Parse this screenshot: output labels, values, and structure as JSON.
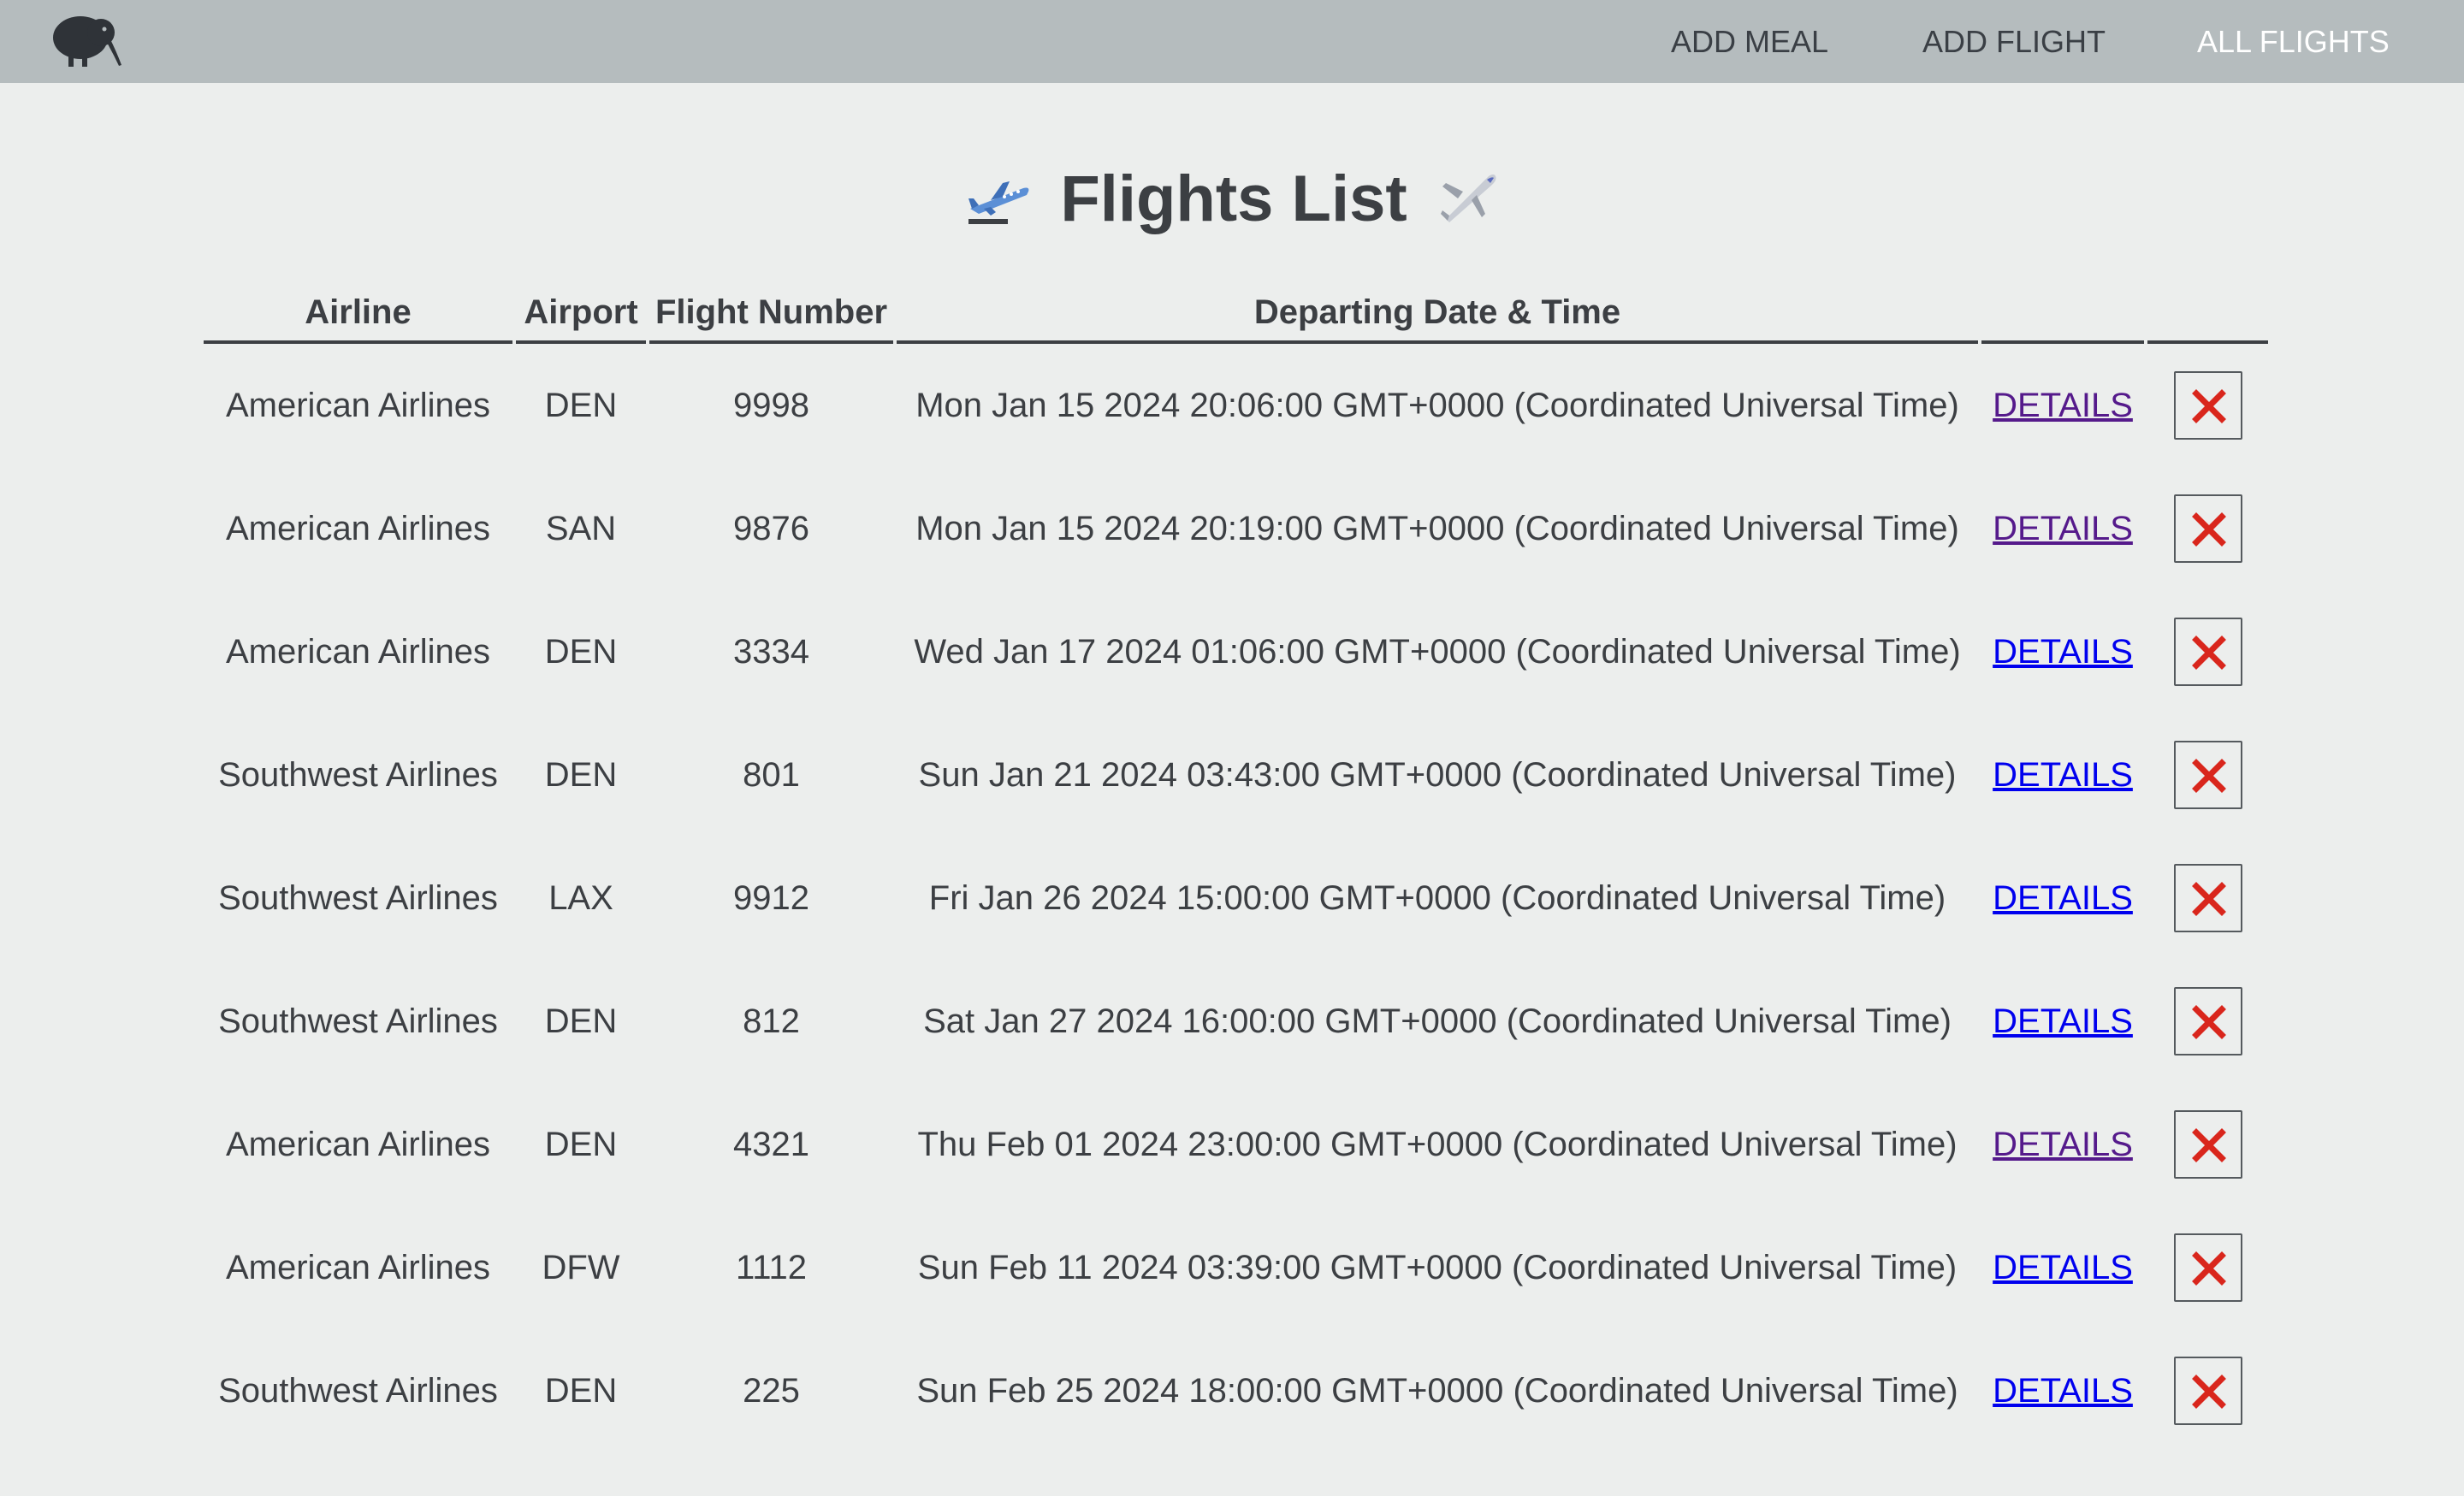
{
  "nav": {
    "logo_icon": "kiwi-bird-icon",
    "links": [
      {
        "label": "ADD MEAL",
        "active": false
      },
      {
        "label": "ADD FLIGHT",
        "active": false
      },
      {
        "label": "ALL FLIGHTS",
        "active": true
      }
    ]
  },
  "page": {
    "title": "Flights List",
    "title_icon_left": "airplane-departure-icon",
    "title_icon_right": "small-airplane-icon"
  },
  "table": {
    "columns": [
      "Airline",
      "Airport",
      "Flight Number",
      "Departing Date & Time",
      "",
      ""
    ],
    "details_label": "DETAILS",
    "delete_icon": "red-x-icon",
    "rows": [
      {
        "airline": "American Airlines",
        "airport": "DEN",
        "flight_number": "9998",
        "departing": "Mon Jan 15 2024 20:06:00 GMT+0000 (Coordinated Universal Time)",
        "details_visited": true
      },
      {
        "airline": "American Airlines",
        "airport": "SAN",
        "flight_number": "9876",
        "departing": "Mon Jan 15 2024 20:19:00 GMT+0000 (Coordinated Universal Time)",
        "details_visited": true
      },
      {
        "airline": "American Airlines",
        "airport": "DEN",
        "flight_number": "3334",
        "departing": "Wed Jan 17 2024 01:06:00 GMT+0000 (Coordinated Universal Time)",
        "details_visited": false
      },
      {
        "airline": "Southwest Airlines",
        "airport": "DEN",
        "flight_number": "801",
        "departing": "Sun Jan 21 2024 03:43:00 GMT+0000 (Coordinated Universal Time)",
        "details_visited": false
      },
      {
        "airline": "Southwest Airlines",
        "airport": "LAX",
        "flight_number": "9912",
        "departing": "Fri Jan 26 2024 15:00:00 GMT+0000 (Coordinated Universal Time)",
        "details_visited": false
      },
      {
        "airline": "Southwest Airlines",
        "airport": "DEN",
        "flight_number": "812",
        "departing": "Sat Jan 27 2024 16:00:00 GMT+0000 (Coordinated Universal Time)",
        "details_visited": false
      },
      {
        "airline": "American Airlines",
        "airport": "DEN",
        "flight_number": "4321",
        "departing": "Thu Feb 01 2024 23:00:00 GMT+0000 (Coordinated Universal Time)",
        "details_visited": true
      },
      {
        "airline": "American Airlines",
        "airport": "DFW",
        "flight_number": "1112",
        "departing": "Sun Feb 11 2024 03:39:00 GMT+0000 (Coordinated Universal Time)",
        "details_visited": false
      },
      {
        "airline": "Southwest Airlines",
        "airport": "DEN",
        "flight_number": "225",
        "departing": "Sun Feb 25 2024 18:00:00 GMT+0000 (Coordinated Universal Time)",
        "details_visited": false
      }
    ]
  },
  "colors": {
    "navbar_bg": "#b5bcbe",
    "page_bg": "#eceeed",
    "text": "#3c3f43",
    "link": "#0000ee",
    "link_visited": "#551a8b",
    "delete_x": "#d9261c",
    "nav_active": "#ffffff"
  }
}
